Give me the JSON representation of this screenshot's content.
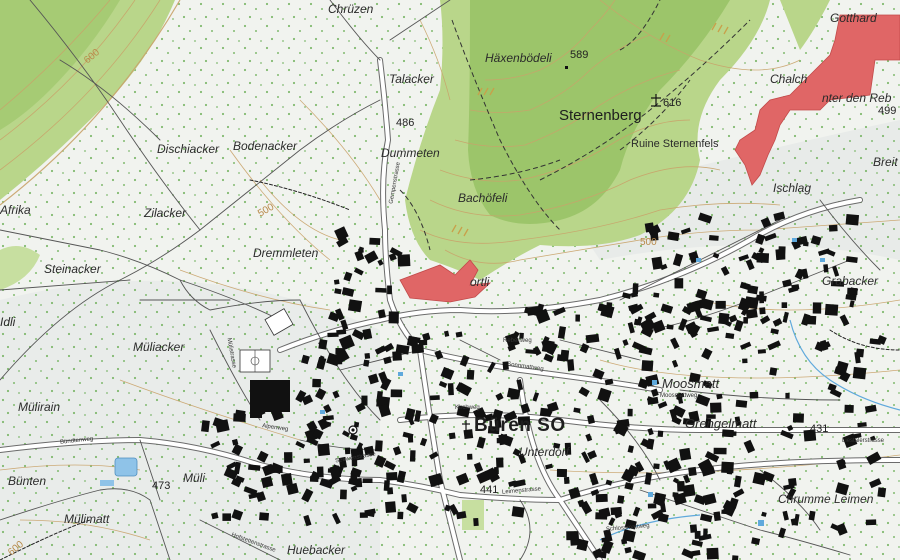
{
  "map": {
    "colors": {
      "forest": "#b9d68a",
      "forest_dark": "#7fb04e",
      "landuse_red": "#e06666",
      "building": "#111111",
      "road": "#ffffff",
      "contour": "#c9a36a",
      "water": "#8fc3e8"
    },
    "labels": {
      "chruzen": "Chrüzen",
      "haxenbodeli": "Häxenbödeli",
      "talacker": "Talacker",
      "sternenberg": "Sternenberg",
      "ruine": "Ruine Sternenfels",
      "dischiacker": "Dischiacker",
      "bodenacker": "Bodenacker",
      "dummeten": "Dummeten",
      "afrika": "Afrika",
      "zilacker": "Zilacker",
      "bachofeli": "Bachöfeli",
      "ischlag": "Ischlag",
      "steinacker": "Steinacker",
      "dremmleten": "Dremmleten",
      "idli": "Idli",
      "grabacker": "Grabacker",
      "muliacker": "Müliacker",
      "moosmatt": "Moosmatt",
      "mulirain": "Mülirain",
      "buren": "Büren SO",
      "grengelmatt": "Grengelmatt",
      "unterdorf": "Unterdorf",
      "bunten": "Bünten",
      "muli": "Müli",
      "chrumme": "Chrumme Leimen",
      "mulimatt": "Mülimatt",
      "huebacker": "Huebacker",
      "gotthard": "Gotthard",
      "chalch": "Chalch",
      "hinter_den_reb": "nter den Reb",
      "breit": "Breit",
      "ortli": "ortli"
    },
    "elevations": {
      "e589": "589",
      "e616": "616",
      "e486": "486",
      "e499": "499",
      "e431": "431",
      "e473": "473",
      "e441": "441"
    },
    "contours": {
      "c600": "600",
      "c500a": "500",
      "c500b": "500",
      "c600b": "600"
    },
    "streets": {
      "rebenweg": "Rebenweg",
      "sonnmattweg": "Sonnmattweg",
      "kirchweg": "Kirchweg",
      "alpenweg": "Alpenweg",
      "seewenstrasse": "Seewenstrasse",
      "bundtenweg": "Bündtenweg",
      "leimenstrasse": "Leimenstrasse",
      "schlossmattweg": "Schlossmattweg",
      "moosmattweg": "Moosmattweg",
      "gempenstrasse": "Gempenstrasse",
      "mulistrasse": "Mülistrasse",
      "hofstettenstrasse": "Hofstettenstrasse",
      "liestalerstrasse": "Liestalerstrasse"
    }
  }
}
